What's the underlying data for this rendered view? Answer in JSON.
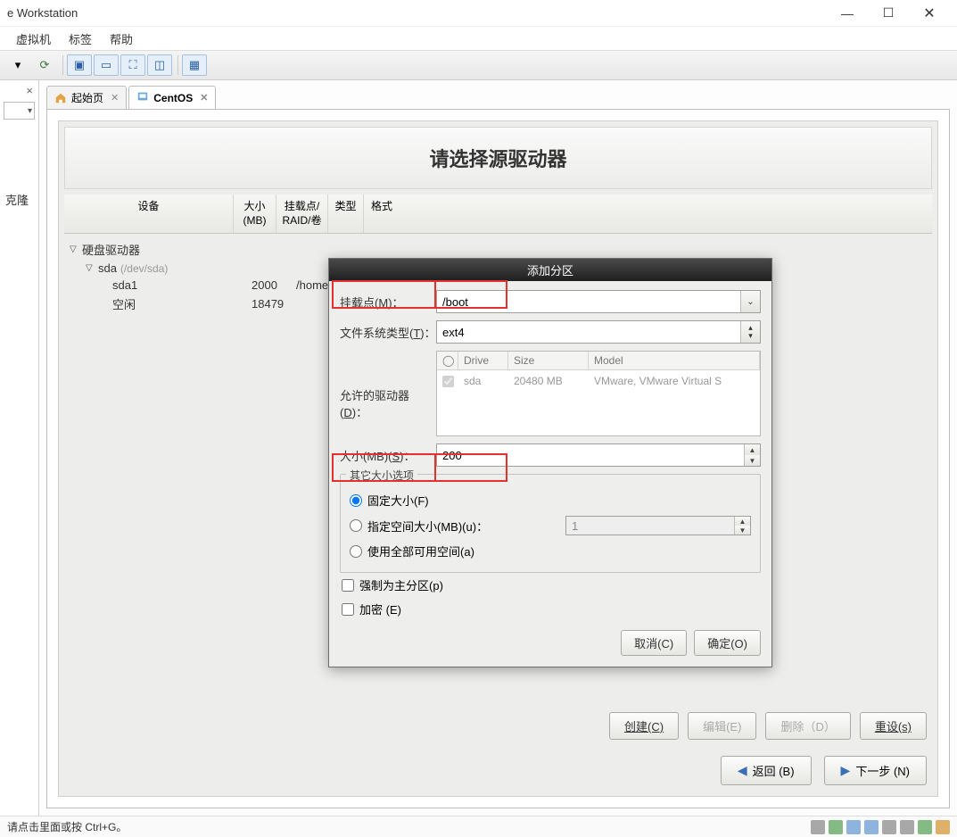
{
  "window": {
    "title": "e Workstation"
  },
  "menu": {
    "vm": "虚拟机",
    "tags": "标签",
    "help": "帮助"
  },
  "sidebar": {
    "close": "×",
    "text": "克隆"
  },
  "tabs": {
    "home": "起始页",
    "centos": "CentOS"
  },
  "page": {
    "title": "请选择源驱动器",
    "cols": {
      "device": "设备",
      "size": "大小\n(MB)",
      "mount": "挂载点/\nRAID/卷",
      "type": "类型",
      "format": "格式"
    },
    "tree": {
      "root": "硬盘驱动器",
      "sda": "sda",
      "sda_dev": "(/dev/sda)",
      "sda1": "sda1",
      "sda1_size": "2000",
      "sda1_mount": "/home",
      "free": "空闲",
      "free_size": "18479"
    },
    "buttons": {
      "create": "创建(C)",
      "edit": "编辑(E)",
      "delete": "删除（D）",
      "reset": "重设(s)"
    },
    "nav": {
      "back": "返回 (B)",
      "next": "下一步 (N)"
    }
  },
  "modal": {
    "title": "添加分区",
    "mount_lbl": "挂载点(",
    "mount_key": "M",
    "mount_lbl2": ")：",
    "mount_val": "/boot",
    "fs_lbl": "文件系统类型(",
    "fs_key": "T",
    "fs_lbl2": ")：",
    "fs_val": "ext4",
    "drives_lbl": "允许的驱动器(",
    "drives_key": "D",
    "drives_lbl2": ")：",
    "drive_cols": {
      "drive": "Drive",
      "size": "Size",
      "model": "Model"
    },
    "drive_row": {
      "drv": "sda",
      "size": "20480 MB",
      "model": "VMware, VMware Virtual S"
    },
    "size_lbl": "大小(MB)(",
    "size_key": "S",
    "size_lbl2": ")：",
    "size_val": "200",
    "other": "其它大小选项",
    "opt_fixed": "固定大小(",
    "opt_fixed_k": "F",
    "opt_fixed2": ")",
    "opt_upto": "指定空间大小(MB)(",
    "opt_upto_k": "u",
    "opt_upto2": ")：",
    "opt_upto_val": "1",
    "opt_all": "使用全部可用空间(",
    "opt_all_k": "a",
    "opt_all2": ")",
    "chk_primary": "强制为主分区(",
    "chk_primary_k": "p",
    "chk_primary2": ")",
    "chk_enc": "加密 (",
    "chk_enc_k": "E",
    "chk_enc2": ")",
    "cancel": "取消(C)",
    "ok": "确定(O)"
  },
  "status": {
    "text": "请点击里面或按 Ctrl+G。"
  }
}
